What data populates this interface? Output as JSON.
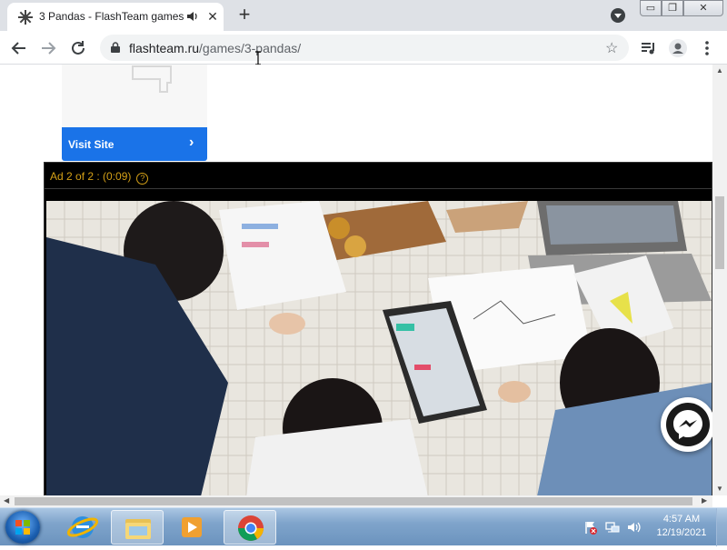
{
  "browser": {
    "tab": {
      "title": "3 Pandas - FlashTeam games",
      "audio_icon": "speaker-icon",
      "close_glyph": "✕"
    },
    "new_tab_glyph": "+",
    "url": {
      "host": "flashteam.ru",
      "path": "/games/3-pandas/"
    },
    "window_controls": {
      "minimize": "▭",
      "maximize": "❐",
      "close": "✕"
    }
  },
  "page": {
    "ad_card": {
      "visit_label": "Visit Site",
      "chevron": "›"
    },
    "video_ad": {
      "status": "Ad 2 of 2 : (0:09)",
      "help_glyph": "?"
    }
  },
  "taskbar": {
    "clock_time": "4:57 AM",
    "clock_date": "12/19/2021"
  }
}
